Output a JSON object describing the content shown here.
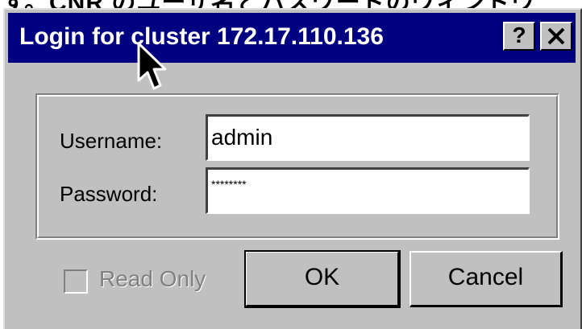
{
  "top_strip_text": "す。CNR のユーザ名とパスワードのウィンドウ",
  "window": {
    "title": "Login for cluster 172.17.110.136",
    "help_button": "?",
    "close_button": "✕"
  },
  "form": {
    "username_label": "Username:",
    "username_value": "admin",
    "password_label": "Password:",
    "password_value": "********"
  },
  "options": {
    "read_only_label": "Read Only",
    "read_only_checked": false
  },
  "buttons": {
    "ok": "OK",
    "cancel": "Cancel"
  },
  "colors": {
    "titlebar": "#000080",
    "dialog_face": "#c0c0c0"
  }
}
